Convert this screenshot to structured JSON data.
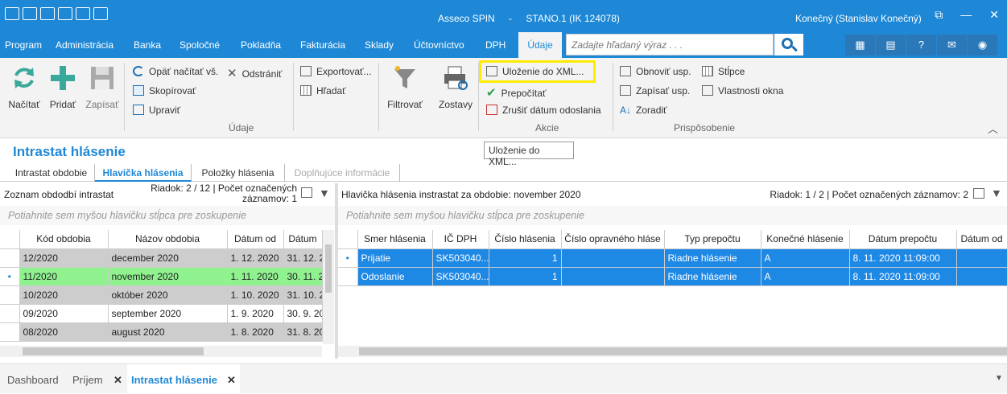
{
  "window": {
    "app": "Asseco SPIN",
    "sep": "-",
    "company": "STANO.1 (IK 124078)",
    "user": "Konečný (Stanislav Konečný)",
    "btn_restore": "⧉",
    "btn_min": "—",
    "btn_close": "✕"
  },
  "menu": [
    "Program",
    "Administrácia",
    "Banka",
    "Spoločné",
    "Pokladňa",
    "Fakturácia",
    "Sklady",
    "Účtovníctvo",
    "DPH"
  ],
  "menu_active": "Údaje",
  "search": {
    "placeholder": "Zadajte hľadaný výraz . . ."
  },
  "ribbon": {
    "nacitat": "Načítať",
    "pridat": "Pridať",
    "zapisat": "Zapísať",
    "opat": "Opäť načítať vš.",
    "odstranit": "Odstrániť",
    "skopirovat": "Skopírovať",
    "upravit": "Upraviť",
    "exportovat": "Exportovať...",
    "hladat": "Hľadať",
    "filtrovat": "Filtrovať",
    "zostavy": "Zostavy",
    "ulozenie": "Uloženie do XML...",
    "prepocitat": "Prepočítať",
    "zrusit": "Zrušiť dátum odoslania",
    "obnovit": "Obnoviť usp.",
    "zapisat_usp": "Zapísať usp.",
    "zoradit": "Zoradiť",
    "stlpce": "Stĺpce",
    "vlastnosti": "Vlastnosti okna",
    "grp_udaje": "Údaje",
    "grp_akcie": "Akcie",
    "grp_prisp": "Prispôsobenie"
  },
  "tooltip": "Uloženie do XML...",
  "page_title": "Intrastat hlásenie",
  "tabs": [
    "Intrastat obdobie",
    "Hlavička hlásenia",
    "Položky hlásenia",
    "Doplňujúce informácie"
  ],
  "left": {
    "title": "Zoznam obdodbí intrastat",
    "rowinfo1": "Riadok: 2 / 12 | Počet označených",
    "rowinfo2": "záznamov: 1",
    "group_hint": "Potiahnite sem myšou hlavičku stĺpca pre zoskupenie",
    "columns": [
      "Kód obdobia",
      "Názov obdobia",
      "Dátum od",
      "Dátum"
    ],
    "rows": [
      [
        "12/2020",
        "december 2020",
        "1. 12. 2020",
        "31. 12. 2"
      ],
      [
        "11/2020",
        "november 2020",
        "1. 11. 2020",
        "30. 11. 2"
      ],
      [
        "10/2020",
        "október 2020",
        "1. 10. 2020",
        "31. 10. 2"
      ],
      [
        "09/2020",
        "september 2020",
        "1. 9. 2020",
        "30. 9. 20"
      ],
      [
        "08/2020",
        "august 2020",
        "1. 8. 2020",
        "31. 8. 20"
      ]
    ]
  },
  "right": {
    "title": "Hlavička hlásenia instrastat za obdobie: november 2020",
    "rowinfo": "Riadok: 1 / 2 | Počet označených záznamov: 2",
    "group_hint": "Potiahnite sem myšou hlavičku stĺpca pre zoskupenie",
    "columns": [
      "Smer hlásenia",
      "IČ DPH",
      "Číslo hlásenia",
      "Číslo opravného hláse",
      "Typ prepočtu",
      "Konečné hlásenie",
      "Dátum prepočtu",
      "Dátum od"
    ],
    "rows": [
      [
        "Prijatie",
        "SK503040...",
        "1",
        "",
        "Riadne hlásenie",
        "A",
        "8. 11. 2020 11:09:00",
        ""
      ],
      [
        "Odoslanie",
        "SK503040...",
        "1",
        "",
        "Riadne hlásenie",
        "A",
        "8. 11. 2020 11:09:00",
        ""
      ]
    ]
  },
  "bottom_tabs": [
    "Dashboard",
    "Príjem",
    "Intrastat hlásenie"
  ]
}
